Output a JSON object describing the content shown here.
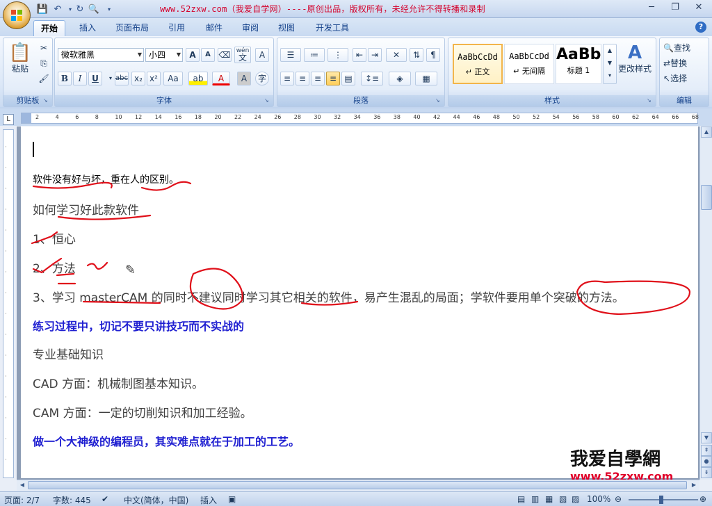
{
  "window": {
    "title": "www.52zxw.com（我爱自学网）----原创出品，版权所有，未经允许不得转播和录制"
  },
  "tabs": [
    {
      "label": "开始",
      "active": true
    },
    {
      "label": "插入"
    },
    {
      "label": "页面布局"
    },
    {
      "label": "引用"
    },
    {
      "label": "邮件"
    },
    {
      "label": "审阅"
    },
    {
      "label": "视图"
    },
    {
      "label": "开发工具"
    }
  ],
  "ribbon": {
    "clipboard": {
      "label": "剪贴板",
      "paste": "粘贴"
    },
    "font": {
      "label": "字体",
      "font_name": "微软雅黑",
      "font_size": "小四",
      "grow": "A",
      "shrink": "A",
      "bold": "B",
      "italic": "I",
      "underline": "U",
      "strike": "abc",
      "sub": "x₂",
      "sup": "x²",
      "case": "Aa",
      "highlight": "ab",
      "color": "A",
      "shade": "A",
      "circle": "字",
      "phonetic": "wén",
      "phonetic_char": "文",
      "border_a": "A"
    },
    "paragraph": {
      "label": "段落"
    },
    "styles": {
      "label": "样式",
      "items": [
        {
          "sample": "AaBbCcDd",
          "name": "↵ 正文"
        },
        {
          "sample": "AaBbCcDd",
          "name": "↵ 无间隔"
        },
        {
          "sample": "AaBb",
          "name": "标题 1"
        }
      ],
      "change": "更改样式"
    },
    "editing": {
      "label": "编辑",
      "find": "查找",
      "replace": "替换",
      "select": "选择"
    }
  },
  "ruler": {
    "numbers": [
      "2",
      "4",
      "6",
      "8",
      "10",
      "12",
      "14",
      "16",
      "18",
      "20",
      "22",
      "24",
      "26",
      "28",
      "30",
      "32",
      "34",
      "36",
      "38",
      "40",
      "42",
      "44",
      "46",
      "48",
      "50",
      "52",
      "54",
      "56",
      "58",
      "60",
      "62",
      "64",
      "66",
      "68"
    ]
  },
  "document": {
    "lines": [
      "软件没有好与坏，重在人的区别。",
      "如何学习好此款软件",
      "1、恒心",
      "2、方法",
      "3、学习 masterCAM 的同时不建议同时学习其它相关的软件，易产生混乱的局面；学软件要用单个突破的方法。",
      "练习过程中，切记不要只讲技巧而不实战的",
      "专业基础知识",
      "CAD 方面：机械制图基本知识。",
      "CAM 方面：一定的切削知识和加工经验。",
      "做一个大神级的编程员，其实难点就在于加工的工艺。"
    ]
  },
  "status": {
    "page": "页面: 2/7",
    "words": "字数: 445",
    "language": "中文(简体，中国)",
    "insert": "插入",
    "zoom": "100%"
  },
  "watermark": {
    "top": "我爱自學網",
    "bottom": "www.52zxw.com"
  }
}
